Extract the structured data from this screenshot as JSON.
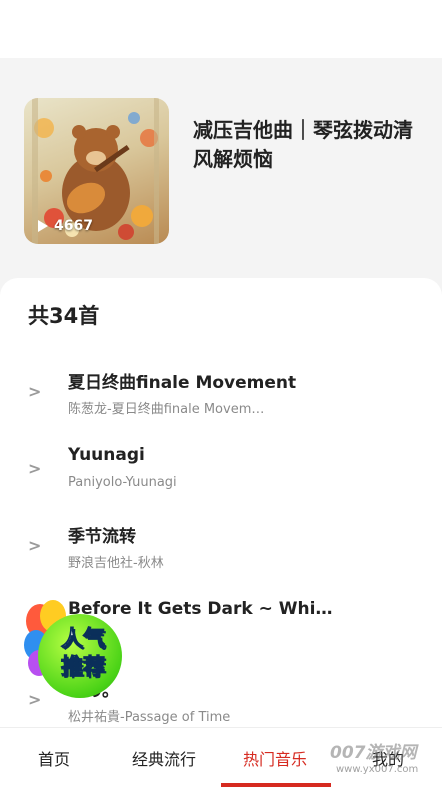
{
  "playlist": {
    "title": "减压吉他曲｜琴弦拨动清风解烦恼",
    "play_count": "4667",
    "cover_icon": "bear-playing-guitar-illustration"
  },
  "songs_section": {
    "count_label": "共34首",
    "songs": [
      {
        "name": "夏日终曲finale Movement",
        "artist": "陈葱龙-夏日终曲finale Movem…",
        "arrow": ">"
      },
      {
        "name": "Yuunagi",
        "artist": "Paniyolo-Yuunagi",
        "arrow": ">"
      },
      {
        "name": "季节流转",
        "artist": "野浪吉他社-秋林",
        "arrow": ">"
      },
      {
        "name": "Before It Gets Dark ~ While T…",
        "artist": "",
        "arrow": ""
      },
      {
        "name": "时の。",
        "artist": "松井祐貴-Passage of Time",
        "arrow": ">"
      }
    ]
  },
  "badge": {
    "line1": "人气",
    "line2": "推荐"
  },
  "tabbar": {
    "tabs": [
      {
        "label": "首页",
        "active": false
      },
      {
        "label": "经典流行",
        "active": false
      },
      {
        "label": "热门音乐",
        "active": true
      },
      {
        "label": "我的",
        "active": false
      }
    ],
    "accent_color": "#d62a20"
  },
  "watermark": {
    "text": "007游戏网",
    "url": "www.yx007.com"
  }
}
